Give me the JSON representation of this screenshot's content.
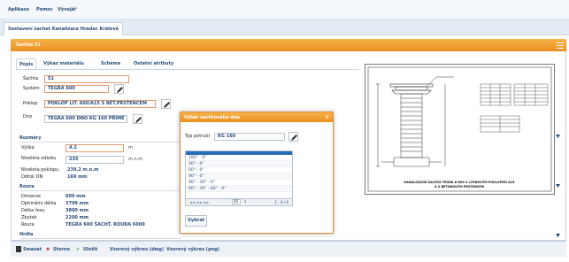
{
  "menu": {
    "items": [
      "Aplikace",
      "Pomoc",
      "Vývojář"
    ]
  },
  "app_tab": "Sestavení šachet Kanalizace Hradec Králové",
  "panel": {
    "title": "Šachta 51"
  },
  "tabs": [
    "Popis",
    "Výkaz materiálu",
    "Schéma",
    "Ostatní atributy"
  ],
  "form": {
    "sachta_label": "Šachta",
    "sachta_value": "51",
    "system_label": "Systém",
    "system_value": "TEGRA 600",
    "poklop_label": "Poklop",
    "poklop_value": "POKLOP LIT. 600/A15 S BET.PRSTENCEM",
    "dno_label": "Dno",
    "dno_value": "TEGRA 600 DNO KG 160 PŘÍMÉ"
  },
  "rozmery": {
    "title": "Rozměry",
    "vyska_label": "Výška",
    "vyska_value": "4.2",
    "vyska_unit": "m",
    "niveleta_odtoku_label": "Niveleta odtoku",
    "niveleta_odtoku_value": "235",
    "niveleta_odtoku_unit": "m.n.m",
    "niveleta_poklopu_label": "Niveleta poklopu",
    "niveleta_poklopu_value": "239,2 m.n.m",
    "odtok_dn_label": "Odtok DN",
    "odtok_dn_value": "160 mm"
  },
  "roura": {
    "title": "Roura",
    "dimenze_label": "Dimenze",
    "dimenze_value": "600 mm",
    "optimalni_label": "Optimální délka",
    "optimalni_value": "3709 mm",
    "delka_rezu_label": "Délka řezu",
    "delka_rezu_value": "3800 mm",
    "zbytek_label": "Zbytek",
    "zbytek_value": "2200 mm",
    "roura_label": "Roura",
    "roura_value": "TEGRA 600 ŠACHT. ROURA 6000"
  },
  "hrdla": {
    "title": "Hrdla"
  },
  "dialog": {
    "title": "Výběr šachtového dna",
    "close": "×",
    "typ_label": "Typ potrubí",
    "typ_value": "KG 160",
    "rows": [
      "180° - 0°",
      "30° - 0°",
      "60° - 0°",
      "90° - 0°",
      "90° - 30° - 0°",
      "90° - 30° - 60° - 0°"
    ],
    "page_value": "40",
    "page_info": "1 - 6 / 6",
    "select_button": "Vybrat"
  },
  "drawing": {
    "caption_line1": "KANALIZAČNÍ ŠACHTA TEGRA Ø 600 S LITINOVÝM POKLOPEM A15",
    "caption_line2": "A S BETONOVÝM PRSTENCEM"
  },
  "toolbar": {
    "delete": "Smazat",
    "cancel": "Storno",
    "save": "Uložit",
    "dwg": "Vzorový výkres (dwg)",
    "png": "Vzorový výkres (png)"
  }
}
